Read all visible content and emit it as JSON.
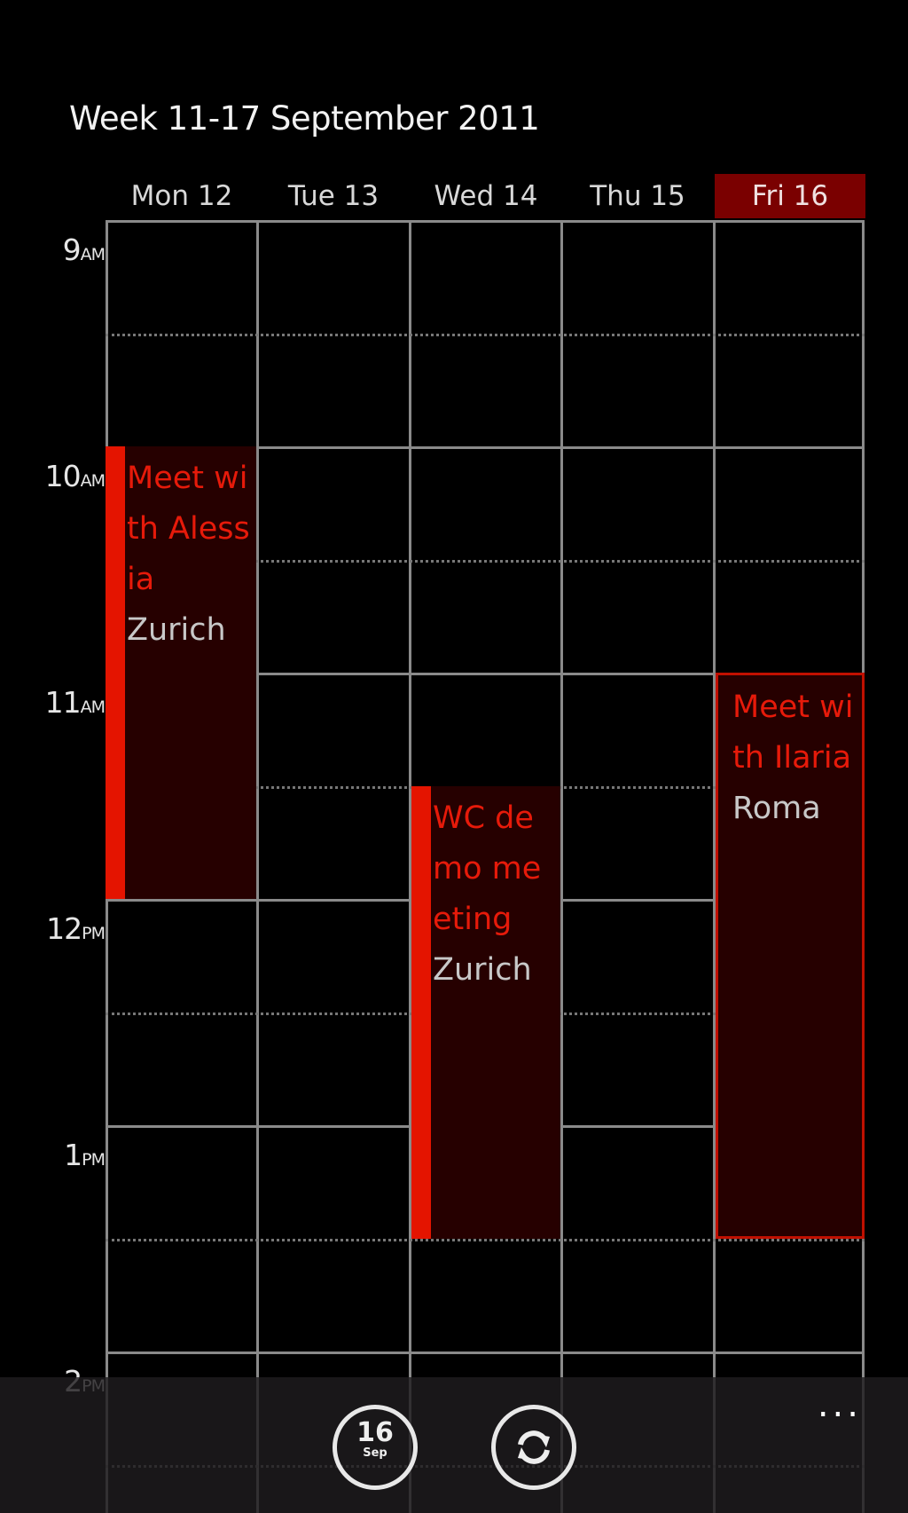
{
  "header": {
    "week_title": "Week 11-17 September 2011"
  },
  "days": [
    {
      "label": "Mon 12",
      "today": false
    },
    {
      "label": "Tue 13",
      "today": false
    },
    {
      "label": "Wed 14",
      "today": false
    },
    {
      "label": "Thu 15",
      "today": false
    },
    {
      "label": "Fri 16",
      "today": true
    }
  ],
  "hours": [
    {
      "num": "9",
      "ampm": "AM"
    },
    {
      "num": "10",
      "ampm": "AM"
    },
    {
      "num": "11",
      "ampm": "AM"
    },
    {
      "num": "12",
      "ampm": "PM"
    },
    {
      "num": "1",
      "ampm": "PM"
    },
    {
      "num": "2",
      "ampm": "PM"
    }
  ],
  "events": [
    {
      "title": "Meet with Alessia",
      "location": "Zurich",
      "day": "Mon 12",
      "start": "10:00",
      "end": "12:00"
    },
    {
      "title": "WC demo meeting",
      "location": "Zurich",
      "day": "Wed 14",
      "start": "11:30",
      "end": "13:30"
    },
    {
      "title": "Meet with Ilaria",
      "location": "Roma",
      "day": "Fri 16",
      "start": "11:00",
      "end": "13:30"
    }
  ],
  "app_bar": {
    "today_button": {
      "day": "16",
      "month": "Sep"
    },
    "sync_icon": "sync-icon",
    "more_label": "..."
  },
  "colors": {
    "accent": "#e41400",
    "today_header": "#7a0000",
    "event_fill": "#260000",
    "grid_line": "#8a8a8a"
  }
}
